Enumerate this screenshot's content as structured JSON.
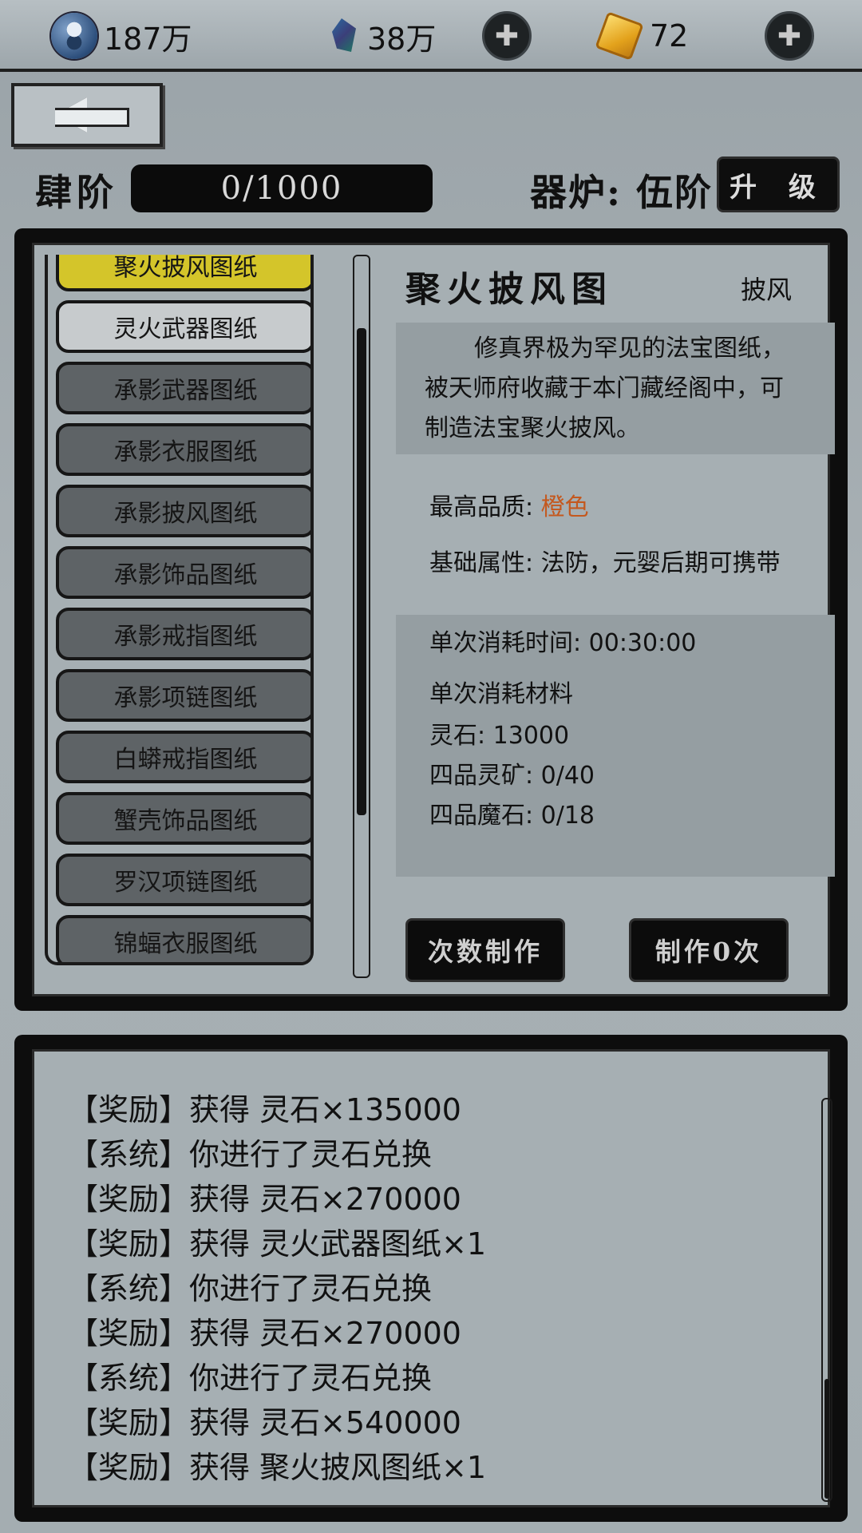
{
  "resources": [
    {
      "icon": "yin-yang-coin-icon",
      "value": "187万"
    },
    {
      "icon": "blue-gem-icon",
      "value": "38万"
    },
    {
      "icon": "gold-ingot-icon",
      "value": "72"
    }
  ],
  "rank": {
    "label": "肆阶",
    "progress_text": "0/1000",
    "progress": 0.0
  },
  "furnace": {
    "label": "器炉: 伍阶",
    "upgrade_label": "升 级"
  },
  "blueprints": [
    {
      "name": "聚火披风图纸",
      "state": "active"
    },
    {
      "name": "灵火武器图纸",
      "state": "selected"
    },
    {
      "name": "承影武器图纸",
      "state": "normal"
    },
    {
      "name": "承影衣服图纸",
      "state": "normal"
    },
    {
      "name": "承影披风图纸",
      "state": "normal"
    },
    {
      "name": "承影饰品图纸",
      "state": "normal"
    },
    {
      "name": "承影戒指图纸",
      "state": "normal"
    },
    {
      "name": "承影项链图纸",
      "state": "normal"
    },
    {
      "name": "白蟒戒指图纸",
      "state": "normal"
    },
    {
      "name": "蟹壳饰品图纸",
      "state": "normal"
    },
    {
      "name": "罗汉项链图纸",
      "state": "normal"
    },
    {
      "name": "锦蝠衣服图纸",
      "state": "normal"
    }
  ],
  "detail": {
    "title": "聚火披风图",
    "type": "披风",
    "description": "修真界极为罕见的法宝图纸，被天师府收藏于本门藏经阁中，可制造法宝聚火披风。",
    "quality_label": "最高品质:",
    "quality_value": "橙色",
    "attr": "基础属性: 法防，元婴后期可携带",
    "time": "单次消耗时间: 00:30:00",
    "materials_title": "单次消耗材料",
    "materials": [
      "灵石: 13000",
      "四品灵矿: 0/40",
      "四品魔石: 0/18"
    ],
    "btn_batch": "次数制作",
    "btn_make": "制作0次"
  },
  "log": [
    "【奖励】获得 灵石×135000",
    "【系统】你进行了灵石兑换",
    "【奖励】获得 灵石×270000",
    "【奖励】获得 灵火武器图纸×1",
    "【系统】你进行了灵石兑换",
    "【奖励】获得 灵石×270000",
    "【系统】你进行了灵石兑换",
    "【奖励】获得 灵石×540000",
    "【奖励】获得 聚火披风图纸×1"
  ]
}
